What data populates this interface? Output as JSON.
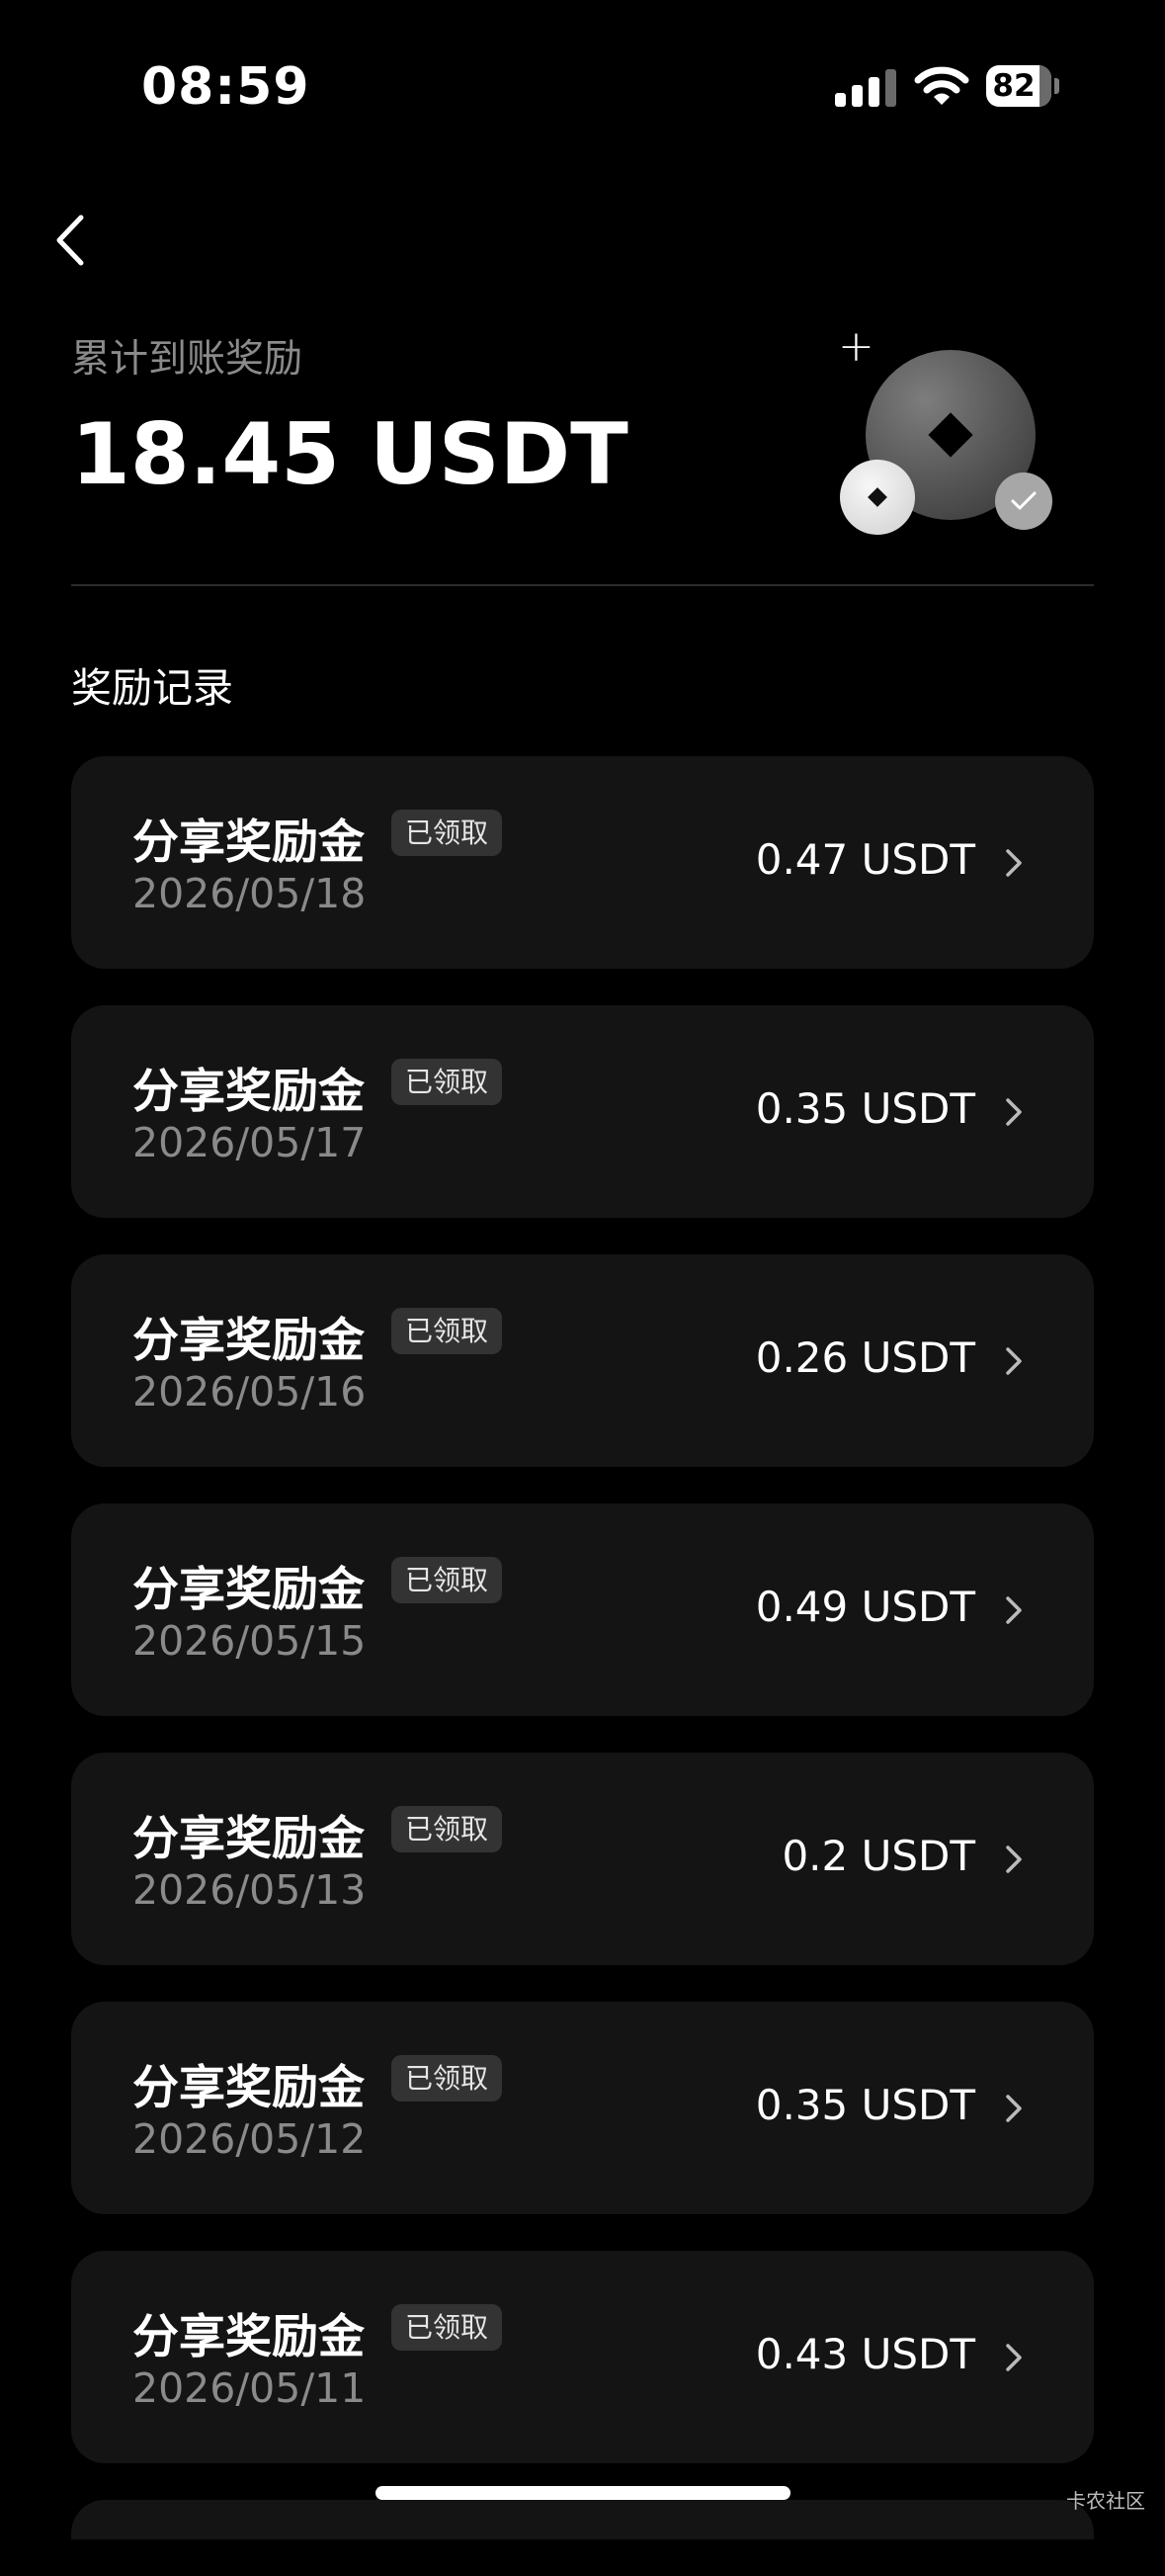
{
  "status_bar": {
    "time": "08:59",
    "battery": "82",
    "icons": [
      "cellular-signal-icon",
      "wifi-icon",
      "battery-icon"
    ]
  },
  "header": {
    "back_icon": "chevron-left-icon"
  },
  "summary": {
    "label": "累计到账奖励",
    "amount": "18.45 USDT"
  },
  "records": {
    "title": "奖励记录",
    "items": [
      {
        "name": "分享奖励金",
        "status": "已领取",
        "date": "2026/05/18",
        "amount": "0.47 USDT"
      },
      {
        "name": "分享奖励金",
        "status": "已领取",
        "date": "2026/05/17",
        "amount": "0.35 USDT"
      },
      {
        "name": "分享奖励金",
        "status": "已领取",
        "date": "2026/05/16",
        "amount": "0.26 USDT"
      },
      {
        "name": "分享奖励金",
        "status": "已领取",
        "date": "2026/05/15",
        "amount": "0.49 USDT"
      },
      {
        "name": "分享奖励金",
        "status": "已领取",
        "date": "2026/05/13",
        "amount": "0.2 USDT"
      },
      {
        "name": "分享奖励金",
        "status": "已领取",
        "date": "2026/05/12",
        "amount": "0.35 USDT"
      },
      {
        "name": "分享奖励金",
        "status": "已领取",
        "date": "2026/05/11",
        "amount": "0.43 USDT"
      }
    ]
  },
  "watermark": "卡农社区"
}
